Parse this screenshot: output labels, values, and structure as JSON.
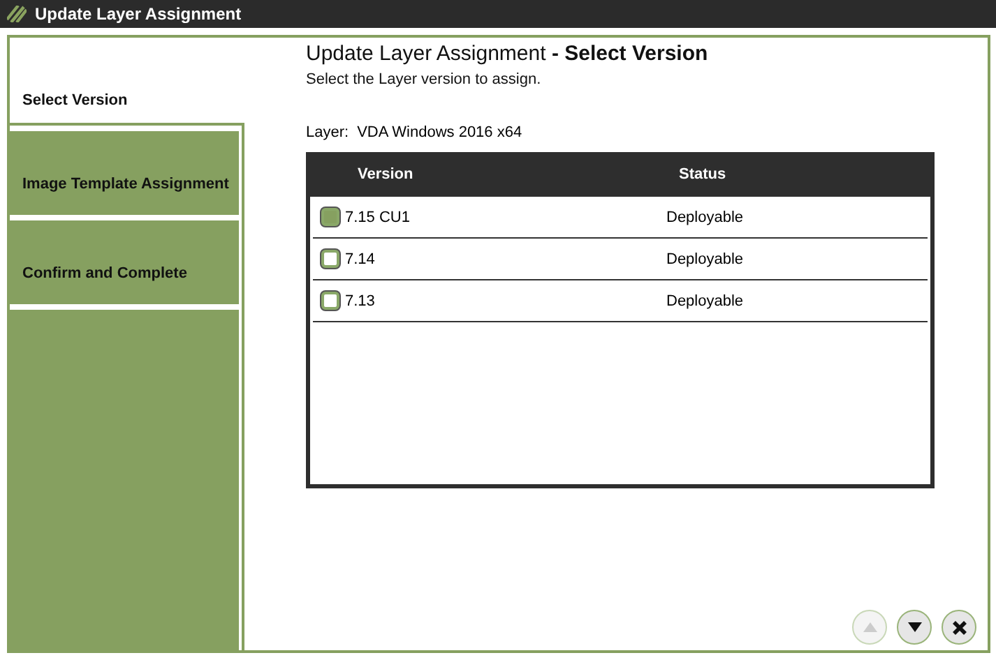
{
  "window": {
    "title": "Update Layer Assignment"
  },
  "steps": [
    {
      "label": "Select Version",
      "selected": true
    },
    {
      "label": "Image Template Assignment",
      "selected": false
    },
    {
      "label": "Confirm and Complete",
      "selected": false
    }
  ],
  "heading": {
    "title": "Update Layer Assignment",
    "separator": "-",
    "step": "Select Version"
  },
  "instruction": "Select the Layer version to assign.",
  "layer": {
    "label": "Layer:",
    "value": "VDA Windows 2016 x64"
  },
  "table": {
    "columns": [
      "Version",
      "Status"
    ],
    "rows": [
      {
        "version": "7.15 CU1",
        "status": "Deployable",
        "selected": true
      },
      {
        "version": "7.14",
        "status": "Deployable",
        "selected": false
      },
      {
        "version": "7.13",
        "status": "Deployable",
        "selected": false
      }
    ]
  },
  "nav": {
    "up_disabled": true,
    "down_disabled": false
  }
}
